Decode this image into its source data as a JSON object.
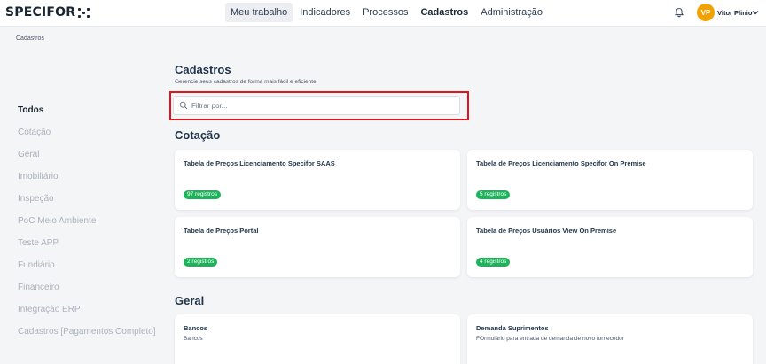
{
  "app": {
    "logo_text": "SPECIFOR"
  },
  "nav": {
    "items": [
      {
        "label": "Meu trabalho"
      },
      {
        "label": "Indicadores"
      },
      {
        "label": "Processos"
      },
      {
        "label": "Cadastros"
      },
      {
        "label": "Administração"
      }
    ]
  },
  "user": {
    "initials": "VP",
    "name": "Vitor Plinio",
    "avatar_color": "#f2a200"
  },
  "breadcrumb": "Cadastros",
  "sidebar": {
    "items": [
      {
        "label": "Todos"
      },
      {
        "label": "Cotação"
      },
      {
        "label": "Geral"
      },
      {
        "label": "Imobiliário"
      },
      {
        "label": "Inspeção"
      },
      {
        "label": "PoC Meio Ambiente"
      },
      {
        "label": "Teste APP"
      },
      {
        "label": "Fundiário"
      },
      {
        "label": "Financeiro"
      },
      {
        "label": "Integração ERP"
      },
      {
        "label": "Cadastros [Pagamentos Completo]"
      }
    ]
  },
  "page": {
    "title": "Cadastros",
    "subtitle": "Gerencie seus cadastros de forma mais fácil e eficiente.",
    "search_placeholder": "Filtrar por..."
  },
  "sections": [
    {
      "title": "Cotação",
      "cards": [
        {
          "title": "Tabela de Preços Licenciamento Specifor SAAS",
          "badge": "97 registros"
        },
        {
          "title": "Tabela de Preços Licenciamento Specifor On Premise",
          "badge": "5 registros"
        },
        {
          "title": "Tabela de Preços Portal",
          "badge": "2 registros"
        },
        {
          "title": "Tabela de Preços Usuários View On Premise",
          "badge": "4 registros"
        }
      ]
    },
    {
      "title": "Geral",
      "cards": [
        {
          "title": "Bancos",
          "description": "Bancos"
        },
        {
          "title": "Demanda Suprimentos",
          "description": "FOrmulário para entrada de demanda de novo fornecedor"
        }
      ]
    }
  ],
  "colors": {
    "accent_badge": "#1eb35a",
    "highlight_border": "#e0141a",
    "title_text": "#1f3349"
  },
  "icons": {
    "bell": "bell-icon",
    "search": "search-icon",
    "chevron": "chevron-down-icon"
  }
}
